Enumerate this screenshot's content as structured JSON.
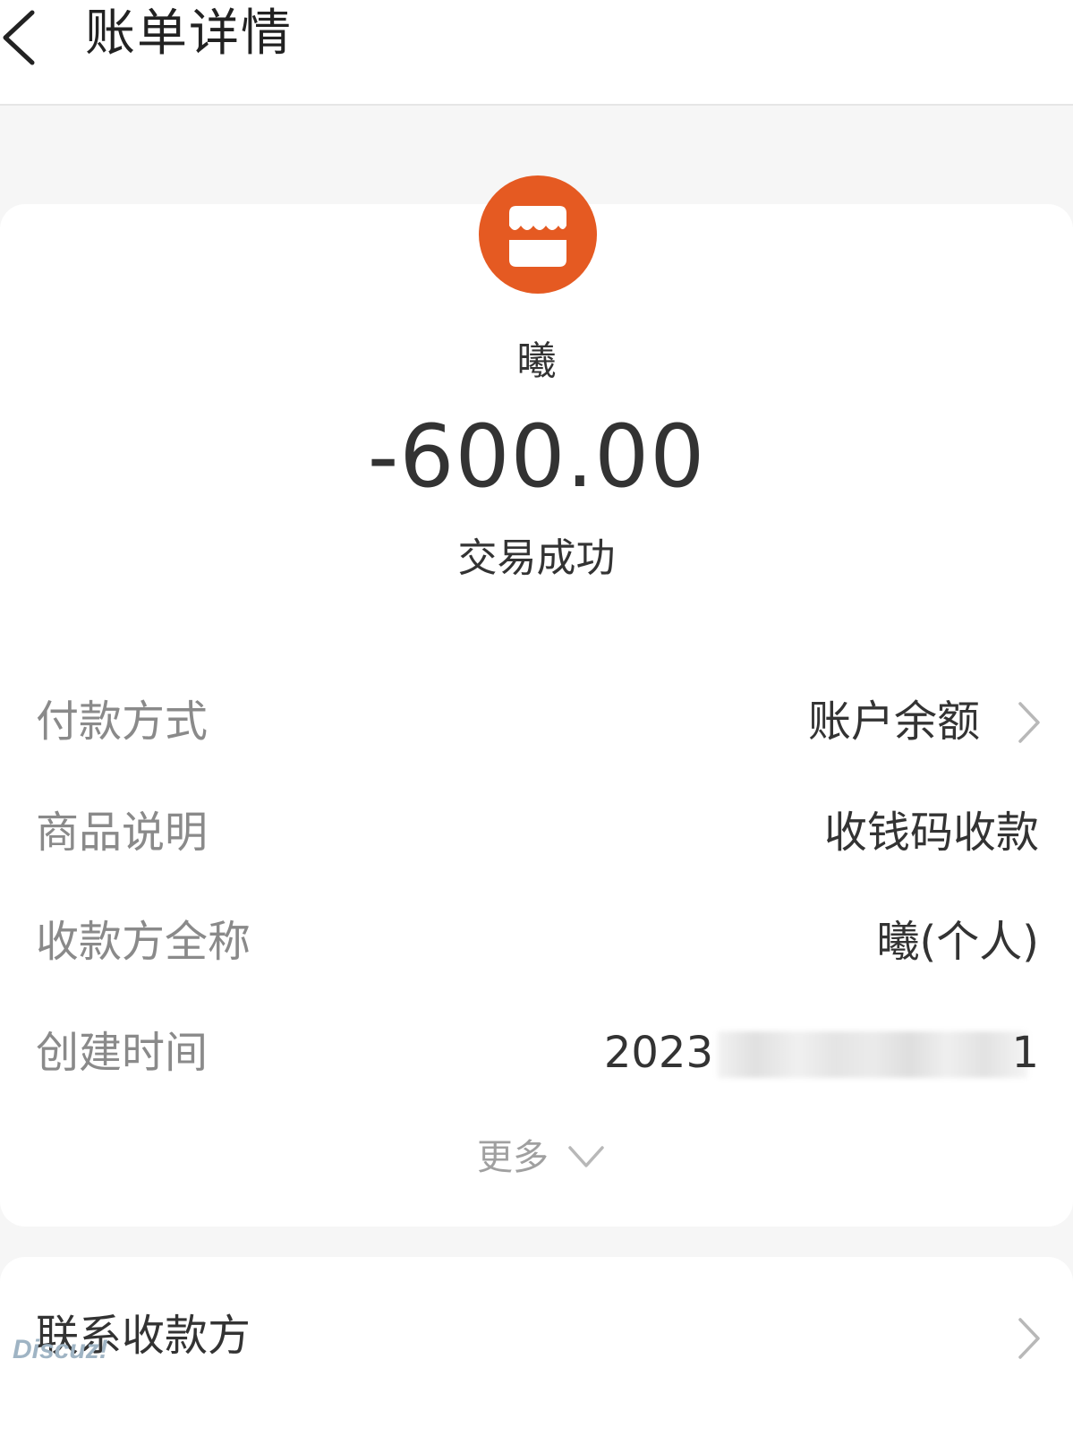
{
  "header": {
    "title": "账单详情"
  },
  "payee": {
    "name": "曦"
  },
  "transaction": {
    "amount": "-600.00",
    "status": "交易成功"
  },
  "details": {
    "payment_method": {
      "label": "付款方式",
      "value": "账户余额"
    },
    "product_desc": {
      "label": "商品说明",
      "value": "收钱码收款"
    },
    "payee_full_name": {
      "label": "收款方全称",
      "value": "曦(个人)"
    },
    "created_time": {
      "label": "创建时间",
      "value_prefix": "2023",
      "value_suffix": "1"
    }
  },
  "more": {
    "label": "更多"
  },
  "contact": {
    "label": "联系收款方"
  },
  "watermark": {
    "text": "Discuz!"
  },
  "colors": {
    "accent": "#e55a22",
    "label_gray": "#8a8a8a",
    "text": "#333333"
  },
  "icons": {
    "back": "chevron-left-icon",
    "avatar": "shop-icon",
    "arrow": "chevron-right-icon",
    "expand": "chevron-down-icon"
  }
}
